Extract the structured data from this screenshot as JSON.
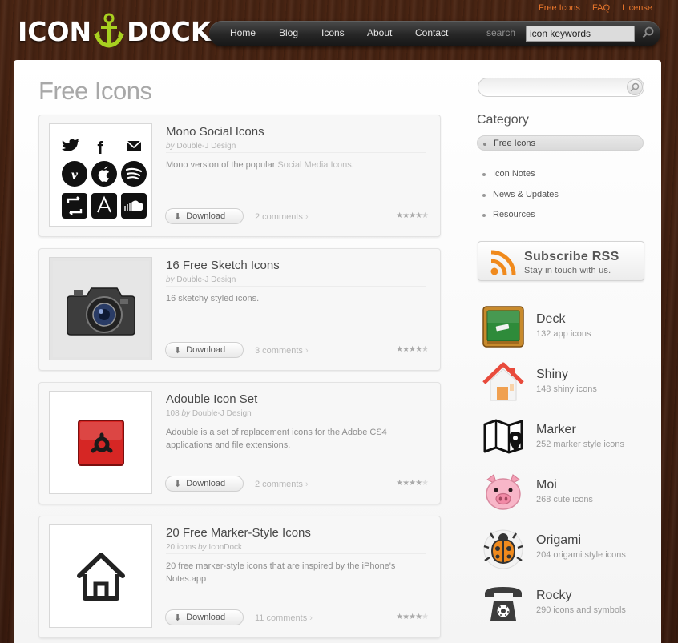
{
  "header": {
    "logo_left": "ICON",
    "logo_right": "DOCK",
    "toplinks": [
      "Free Icons",
      "FAQ",
      "License"
    ],
    "nav": [
      "Home",
      "Blog",
      "Icons",
      "About",
      "Contact"
    ],
    "search_label": "search",
    "search_value": "icon keywords"
  },
  "main": {
    "title": "Free Icons",
    "cards": [
      {
        "title": "Mono Social Icons",
        "by_prefix": "",
        "by_word": "by",
        "author": "Double-J Design",
        "desc": "Mono version of the popular ",
        "desc_link": "Social Media Icons",
        "desc_suffix": ".",
        "download": "Download",
        "comments": "2 comments",
        "rating": 4.5
      },
      {
        "title": "16 Free Sketch Icons",
        "by_prefix": "",
        "by_word": "by",
        "author": "Double-J Design",
        "desc": "16 sketchy styled icons.",
        "desc_link": "",
        "desc_suffix": "",
        "download": "Download",
        "comments": "3 comments",
        "rating": 4.5
      },
      {
        "title": "Adouble Icon Set",
        "by_prefix": "108 ",
        "by_word": "by",
        "author": "Double-J Design",
        "desc": "Adouble is a set of replacement icons for the Adobe CS4 applications and file extensions.",
        "desc_link": "",
        "desc_suffix": "",
        "download": "Download",
        "comments": "2 comments",
        "rating": 4
      },
      {
        "title": "20 Free Marker-Style Icons",
        "by_prefix": "20 icons ",
        "by_word": "by",
        "author": "IconDock",
        "desc": "20 free marker-style icons that are inspired by the iPhone's Notes.app",
        "desc_link": "",
        "desc_suffix": "",
        "download": "Download",
        "comments": "11 comments",
        "rating": 4
      }
    ]
  },
  "sidebar": {
    "search_value": "",
    "category_title": "Category",
    "categories": [
      "Free Icons",
      "Icon Notes",
      "News & Updates",
      "Resources"
    ],
    "rss_title": "Subscribe RSS",
    "rss_sub": "Stay in touch with us.",
    "sets": [
      {
        "name": "Deck",
        "desc": "132 app icons",
        "icon": "chalkboard-icon"
      },
      {
        "name": "Shiny",
        "desc": "148 shiny icons",
        "icon": "house-icon"
      },
      {
        "name": "Marker",
        "desc": "252 marker style icons",
        "icon": "map-icon"
      },
      {
        "name": "Moi",
        "desc": "268 cute icons",
        "icon": "pig-icon"
      },
      {
        "name": "Origami",
        "desc": "204 origami style icons",
        "icon": "ladybug-icon"
      },
      {
        "name": "Rocky",
        "desc": "290 icons and symbols",
        "icon": "telephone-icon"
      }
    ]
  },
  "colors": {
    "accent": "#e8762c",
    "wood": "#3b1d10"
  }
}
